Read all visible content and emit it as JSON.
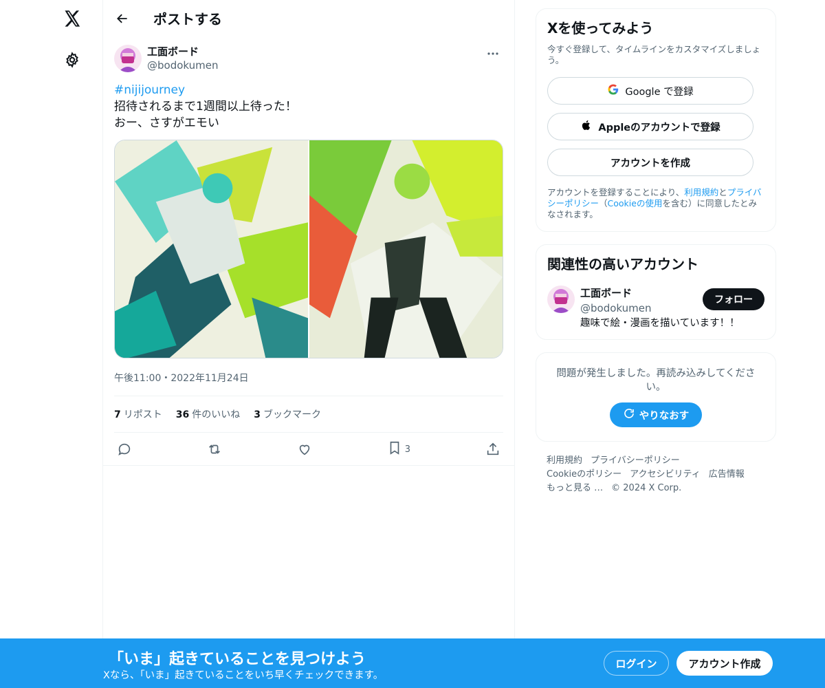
{
  "header": {
    "title": "ポストする"
  },
  "post": {
    "author_name": "工面ボード",
    "author_handle": "@bodokumen",
    "hashtag": "#nijijourney",
    "lines": [
      "招待されるまで1週間以上待った！",
      "おー、さすがエモい"
    ],
    "timestamp": "午後11:00・2022年11月24日",
    "stats": {
      "reposts_count": "7",
      "reposts_label": "リポスト",
      "likes_count": "36",
      "likes_label": "件のいいね",
      "bookmarks_count": "3",
      "bookmarks_label": "ブックマーク"
    },
    "bookmark_action_count": "3"
  },
  "signup_card": {
    "title": "Xを使ってみよう",
    "subtitle": "今すぐ登録して、タイムラインをカスタマイズしましょう。",
    "google_label": "Google で登録",
    "apple_label": "Appleのアカウントで登録",
    "create_label": "アカウントを作成",
    "terms_prefix": "アカウントを登録することにより、",
    "terms_link": "利用規約",
    "terms_and": "と",
    "privacy_link": "プライバシーポリシー",
    "cookie_open": "（",
    "cookie_link": "Cookieの使用",
    "cookie_rest": "を含む）に同意したとみなされます。"
  },
  "related": {
    "title": "関連性の高いアカウント",
    "name": "工面ボード",
    "handle": "@bodokumen",
    "bio": "趣味で絵・漫画を描いています！！",
    "follow_label": "フォロー"
  },
  "error_card": {
    "message": "問題が発生しました。再読み込みしてください。",
    "retry_label": "やりなおす"
  },
  "footer": {
    "links": [
      "利用規約",
      "プライバシーポリシー",
      "Cookieのポリシー",
      "アクセシビリティ",
      "広告情報",
      "もっと見る …",
      "© 2024 X Corp."
    ]
  },
  "banner": {
    "title": "「いま」起きていることを見つけよう",
    "subtitle": "Xなら、「いま」起きていることをいち早くチェックできます。",
    "login_label": "ログイン",
    "signup_label": "アカウント作成"
  },
  "colors": {
    "accent": "#1d9bf0",
    "text": "#0f1419",
    "muted": "#536471",
    "border": "#eff3f4"
  }
}
